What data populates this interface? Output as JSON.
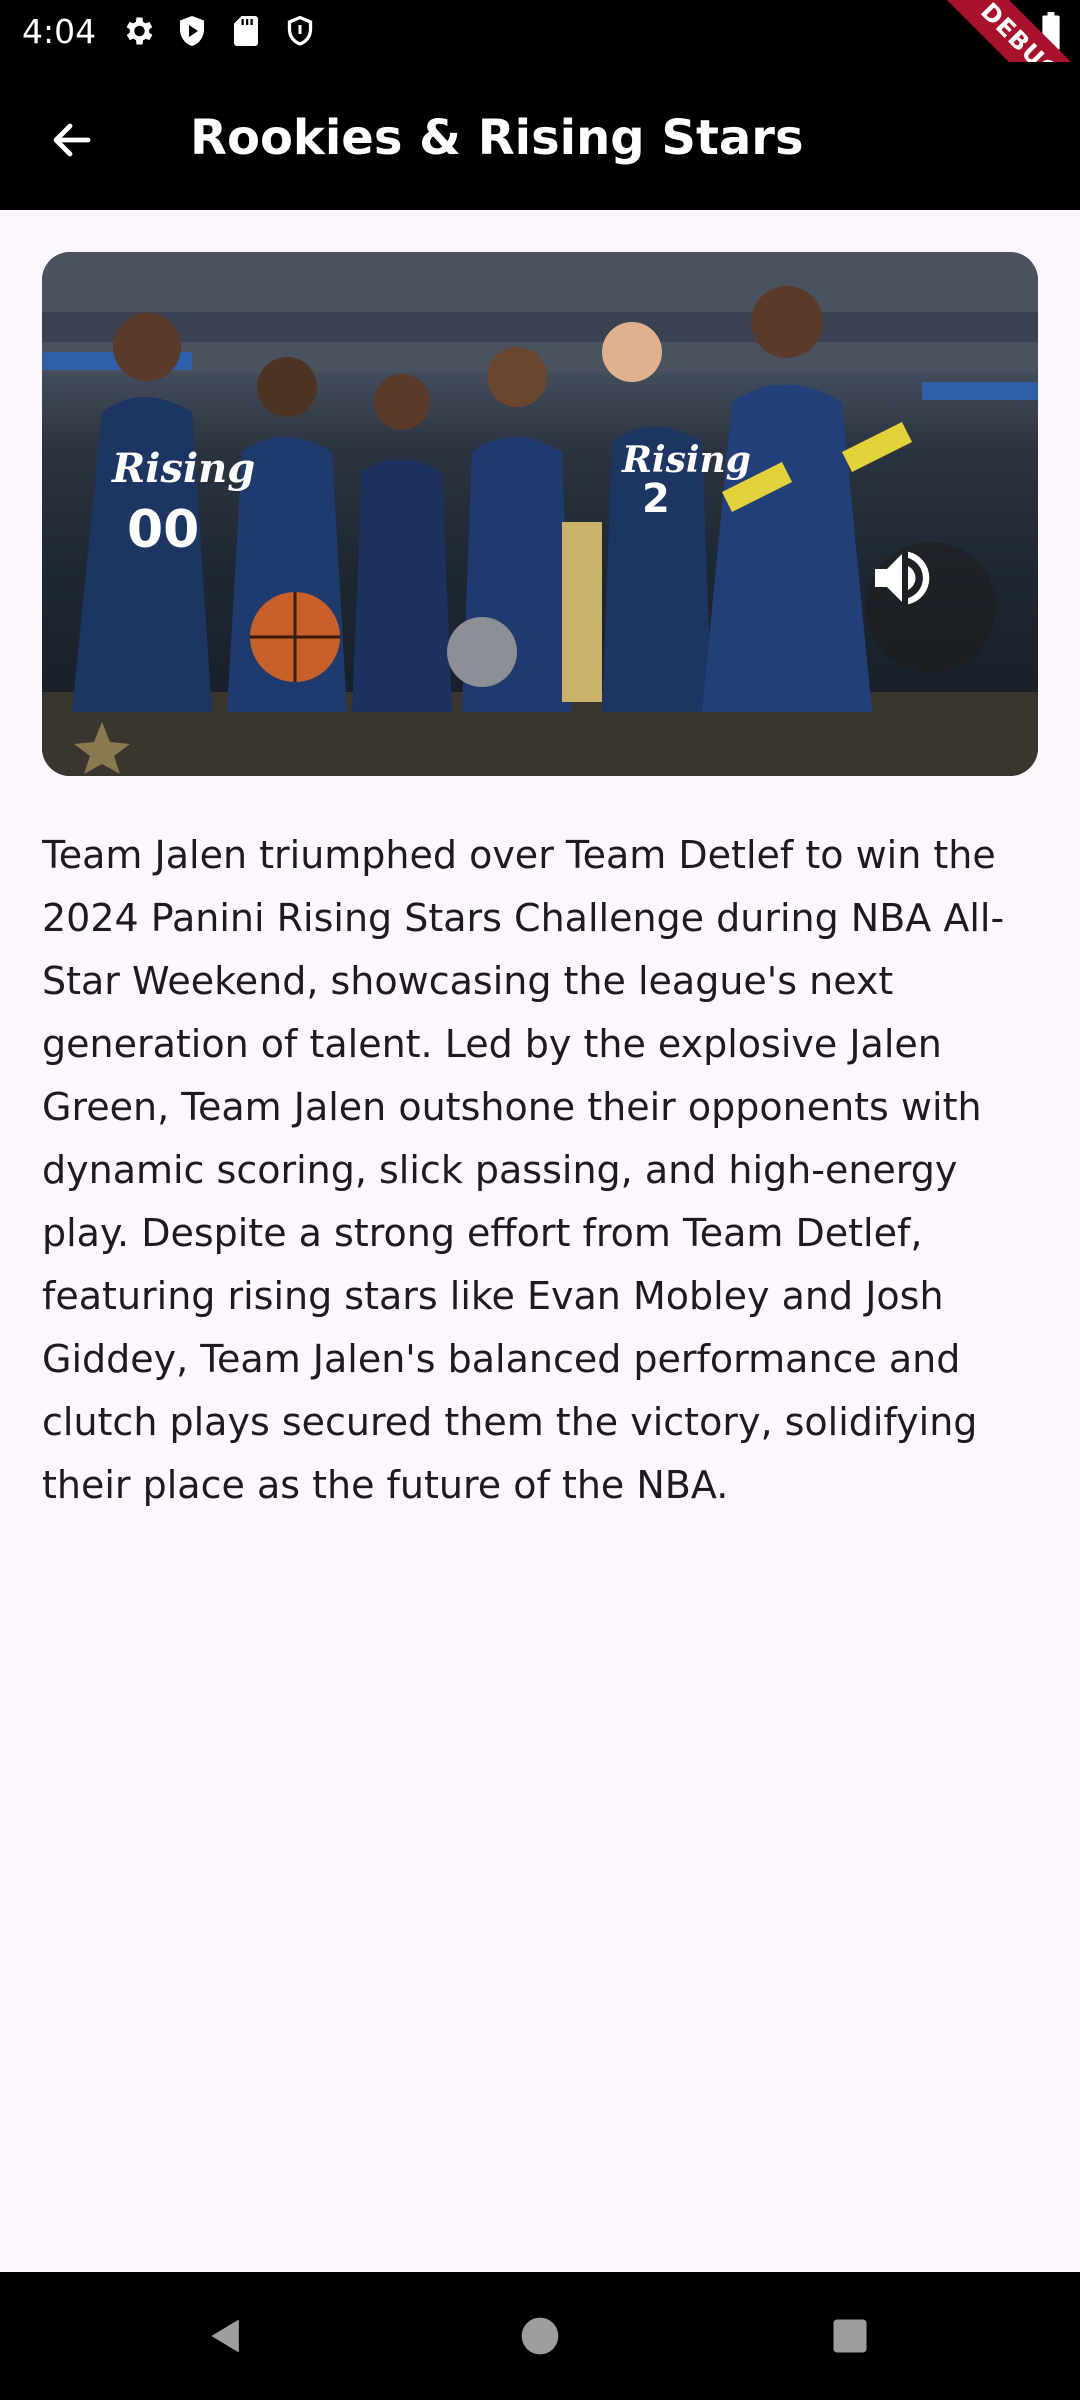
{
  "status_bar": {
    "time": "4:04",
    "debug_label": "DEBUG",
    "left_icons": [
      "gear-icon",
      "play-protect-icon",
      "sd-card-icon",
      "shield-icon"
    ],
    "right_icons": [
      "wifi-icon",
      "battery-icon"
    ]
  },
  "app_bar": {
    "title": "Rookies & Rising Stars",
    "back_icon": "arrow-back-icon"
  },
  "hero": {
    "description_icon": "volume-up-icon",
    "jersey_texts": [
      "Rising",
      "00",
      "Rising",
      "2"
    ]
  },
  "article": {
    "body": "Team Jalen triumphed over Team Detlef to win the 2024 Panini Rising Stars Challenge during NBA All-Star Weekend, showcasing the league's next generation of talent. Led by the explosive Jalen Green, Team Jalen outshone their opponents with dynamic scoring, slick passing, and high-energy play. Despite a strong effort from Team Detlef, featuring rising stars like Evan Mobley and Josh Giddey, Team Jalen's balanced performance and clutch plays secured them the victory, solidifying their place as the future of the NBA."
  },
  "nav_bar": {
    "icons": [
      "nav-back-icon",
      "nav-home-icon",
      "nav-recents-icon"
    ]
  },
  "colors": {
    "background": "#fdf7fd",
    "app_bar": "#000000",
    "text": "#1d1b20",
    "debug_banner": "#a8122a"
  }
}
